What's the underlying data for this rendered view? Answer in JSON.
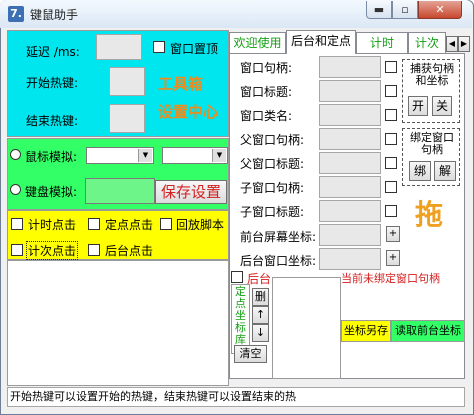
{
  "window": {
    "icon_text": "7.",
    "title": "键鼠助手",
    "min_label": "▬",
    "max_label": "▫",
    "close_label": "✕"
  },
  "left": {
    "delay_label": "延迟 /ms:",
    "window_topmost_label": "窗口置顶",
    "start_hotkey_label": "开始热键:",
    "end_hotkey_label": "结束热键:",
    "toolbox_title": "工具箱",
    "settings_title": "设置中心",
    "mouse_sim_label": "鼠标模拟:",
    "keyboard_sim_label": "键盘模拟:",
    "save_settings_label": "保存设置",
    "timed_click_label": "计时点击",
    "fixed_point_click_label": "定点点击",
    "replay_script_label": "回放脚本",
    "count_click_label": "计次点击",
    "background_click_label": "后台点击"
  },
  "tabs": [
    {
      "label": "欢迎使用",
      "active": false
    },
    {
      "label": "后台和定点",
      "active": true
    },
    {
      "label": "计时",
      "active": false
    },
    {
      "label": "计次",
      "active": false
    }
  ],
  "tab_scroll": {
    "left": "◀",
    "right": "▶"
  },
  "right": {
    "window_handle_label": "窗口句柄:",
    "window_title_label": "窗口标题:",
    "window_class_label": "窗口类名:",
    "parent_handle_label": "父窗口句柄:",
    "parent_title_label": "父窗口标题:",
    "child_handle_label": "子窗口句柄:",
    "child_title_label": "子窗口标题:",
    "foreground_coords_label": "前台屏幕坐标:",
    "background_coords_label": "后台窗口坐标:",
    "plus_label": "+",
    "capture_group_label": "捕获句柄和坐标",
    "open_label": "开",
    "close_label": "关",
    "bind_group_label": "绑定窗口句柄",
    "bind_label": "绑",
    "unbind_label": "解",
    "drag_label": "拖",
    "background_label": "后台",
    "no_bind_status": "当前未绑定窗口句柄",
    "coord_library_label": "定点坐标库",
    "delete_label": "删",
    "up_label": "↑",
    "down_label": "↓",
    "clear_label": "清空",
    "save_coords_as_label": "坐标另存",
    "read_bg_coords_label": "读取前台坐标"
  },
  "status_text": "开始热键可以设置开始的热键，结束热键可以设置结束的热"
}
